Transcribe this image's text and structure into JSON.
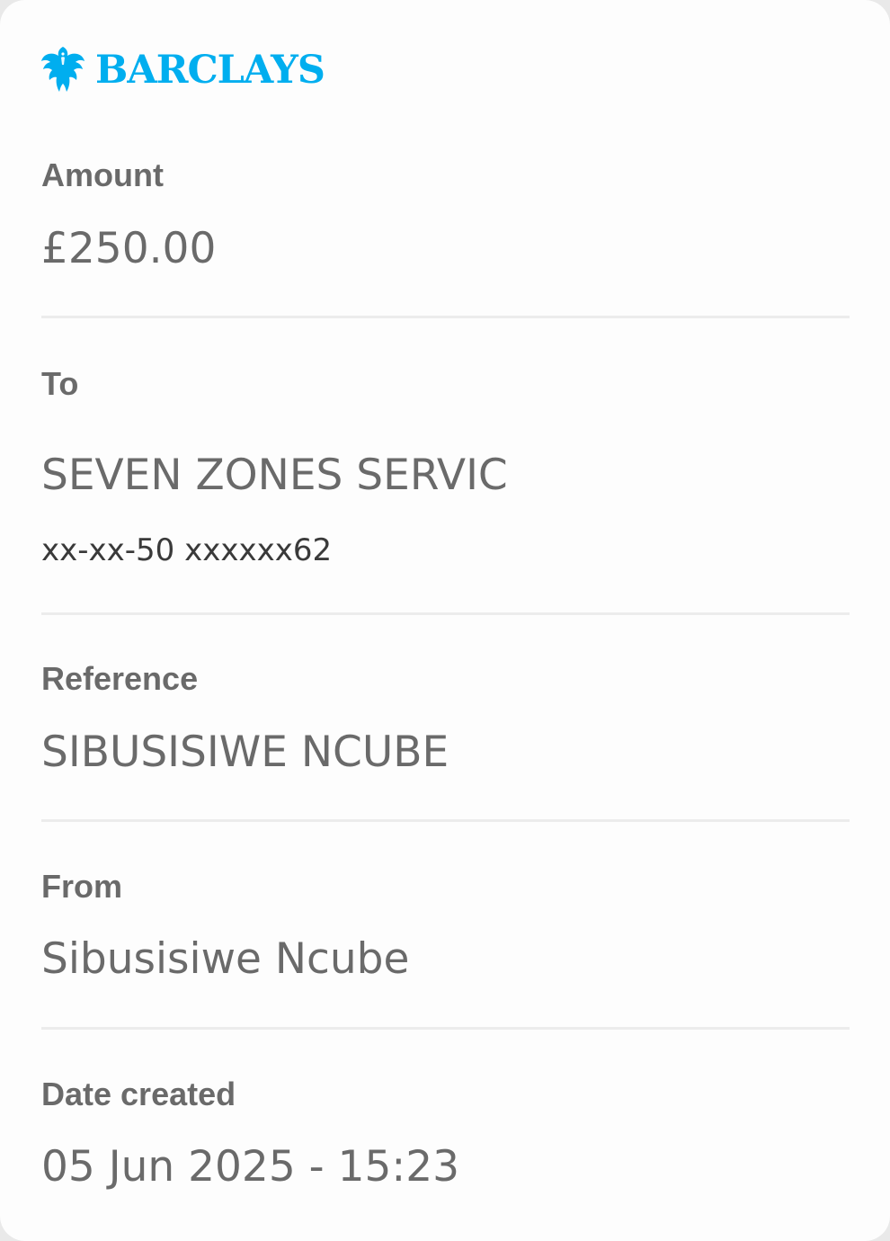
{
  "brand": {
    "name": "BARCLAYS",
    "icon": "eagle-icon",
    "color": "#00aeef"
  },
  "details": {
    "amount": {
      "label": "Amount",
      "value": "£250.00"
    },
    "to": {
      "label": "To",
      "value": "SEVEN ZONES SERVIC",
      "account": "xx-xx-50 xxxxxx62"
    },
    "reference": {
      "label": "Reference",
      "value": "SIBUSISIWE NCUBE"
    },
    "from": {
      "label": "From",
      "value": "Sibusisiwe Ncube"
    },
    "date_created": {
      "label": "Date created",
      "value": "05 Jun 2025 - 15:23"
    }
  }
}
